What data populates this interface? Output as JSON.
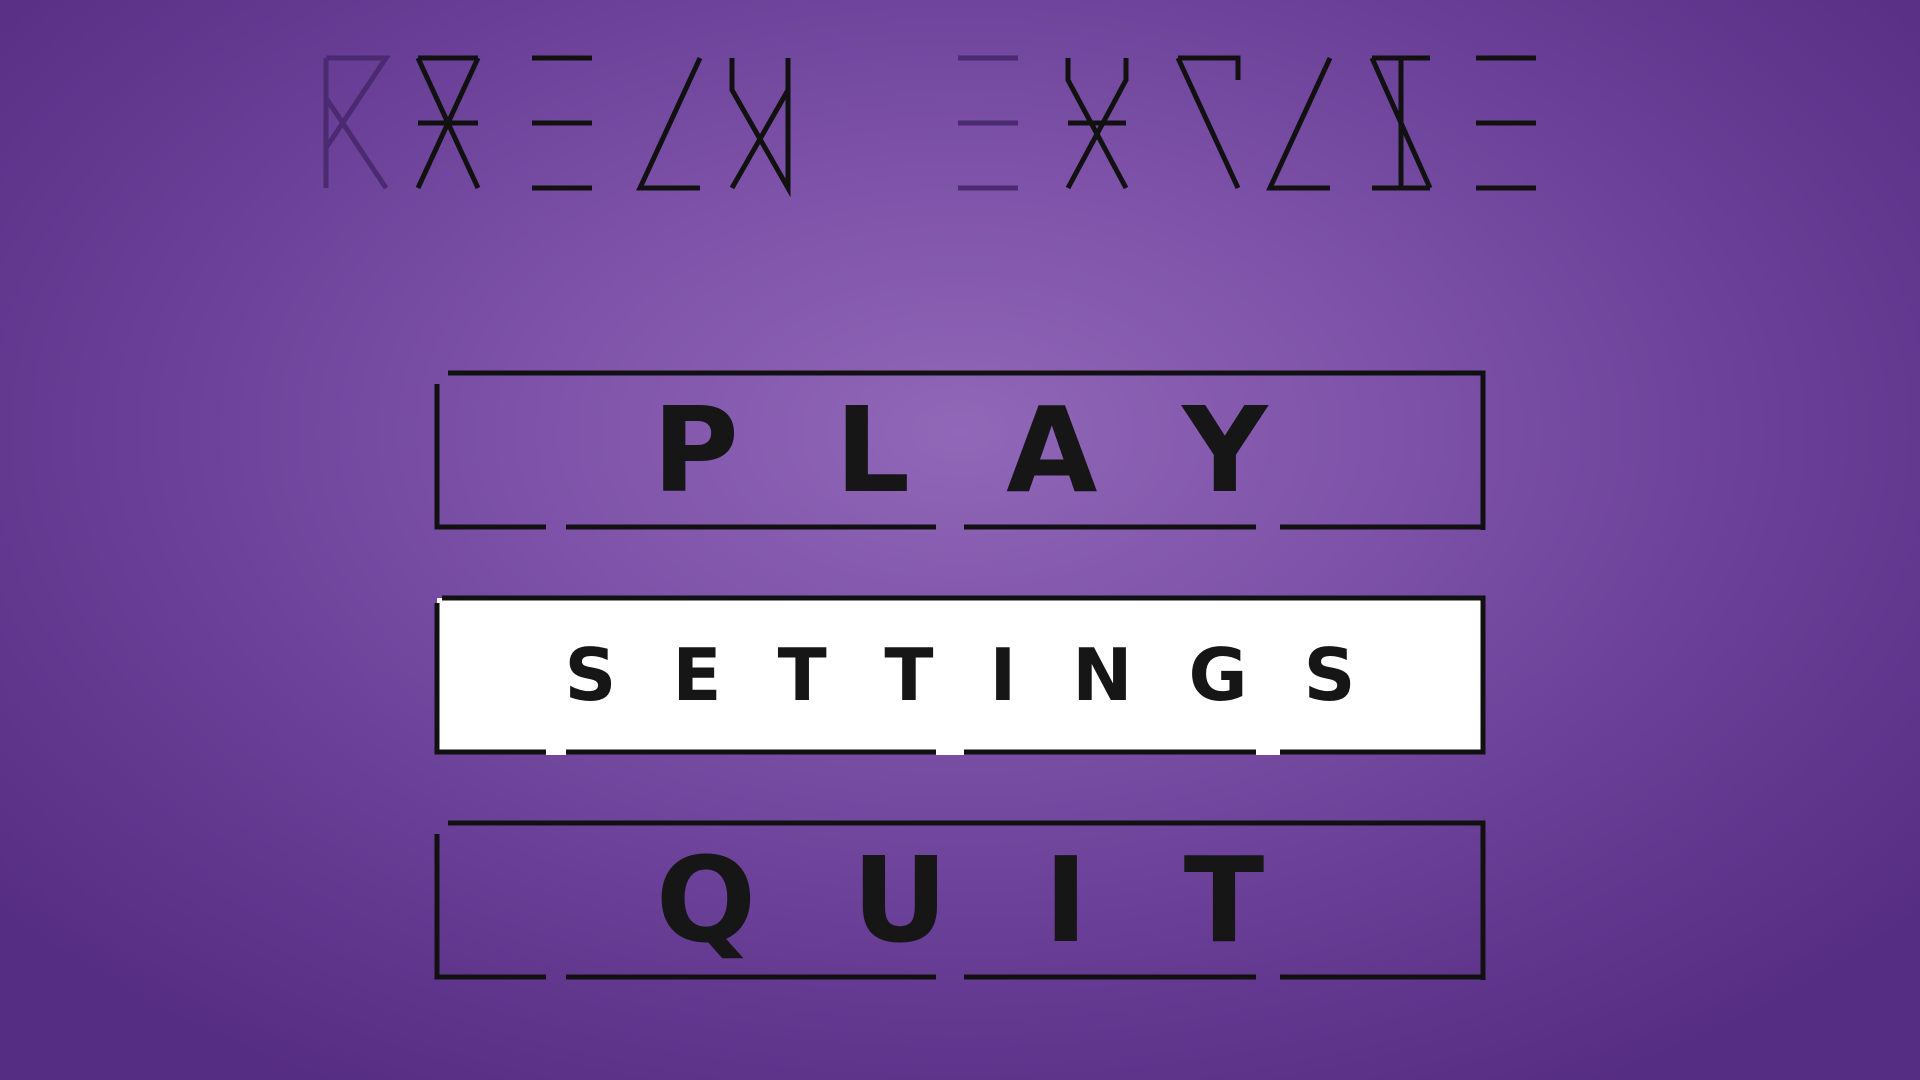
{
  "game": {
    "title_glyphs_description": "stylized runic game title",
    "background_colors": [
      "#9167b8",
      "#552d82"
    ]
  },
  "menu": {
    "items": [
      {
        "id": "play",
        "label": "PLAY",
        "selected": false
      },
      {
        "id": "settings",
        "label": "SETTINGS",
        "selected": true
      },
      {
        "id": "quit",
        "label": "QUIT",
        "selected": false
      }
    ]
  },
  "colors": {
    "frame": "#111111",
    "selected_fill": "#ffffff",
    "text": "#161616",
    "title_faded": "#4a2a70"
  }
}
